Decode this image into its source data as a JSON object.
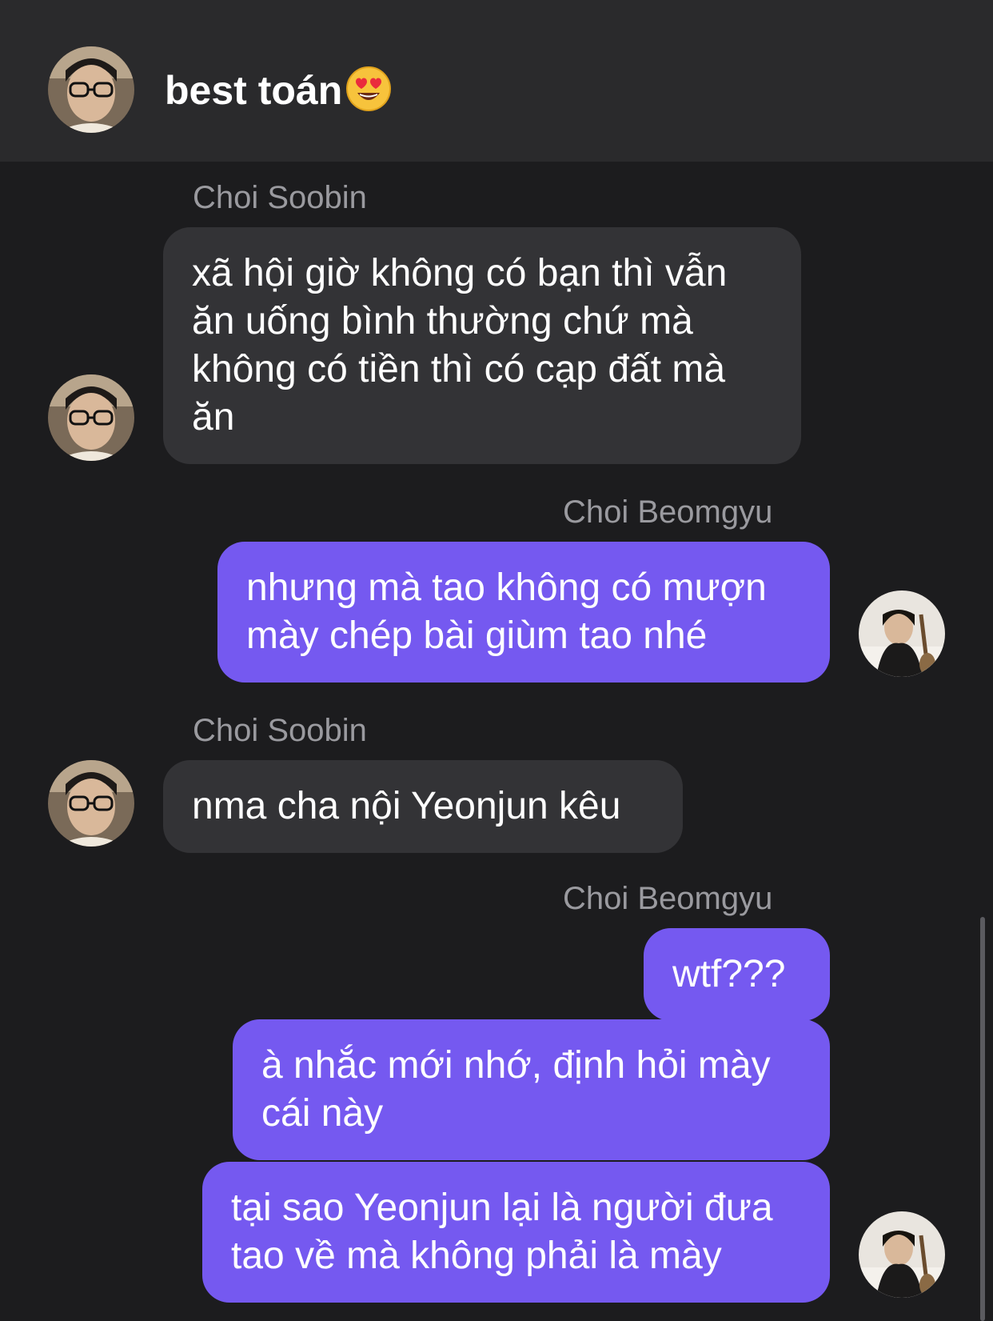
{
  "header": {
    "title": "best toán",
    "emoji_icon": "heart-eyes-emoji"
  },
  "messages": [
    {
      "sender": "Choi Soobin",
      "direction": "incoming",
      "text": "xã hội giờ không có bạn thì vẫn\năn uống bình thường chứ mà\nkhông có tiền thì có cạp đất mà\năn"
    },
    {
      "sender": "Choi Beomgyu",
      "direction": "outgoing",
      "text": "nhưng mà tao không có mượn\nmày chép bài giùm tao nhé"
    },
    {
      "sender": "Choi Soobin",
      "direction": "incoming",
      "text": "nma cha nội Yeonjun kêu"
    },
    {
      "sender": "Choi Beomgyu",
      "direction": "outgoing",
      "text": "wtf???"
    },
    {
      "sender": "",
      "direction": "outgoing",
      "text": "à nhắc mới nhớ, định hỏi mày\ncái này"
    },
    {
      "sender": "",
      "direction": "outgoing",
      "text": "tại sao Yeonjun lại là người đưa\ntao về mà không phải là mày"
    }
  ],
  "colors": {
    "background": "#1c1c1e",
    "header": "#2a2a2c",
    "incoming_bubble": "#333336",
    "outgoing_bubble": "#7559f0",
    "sender_text": "#9a9a9f"
  }
}
